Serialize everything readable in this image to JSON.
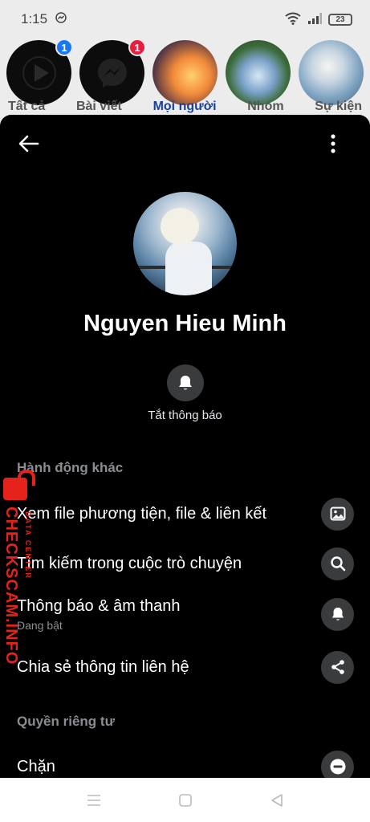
{
  "status_bar": {
    "time": "1:15",
    "battery": "23"
  },
  "background": {
    "badges": [
      "1",
      "1"
    ],
    "tabs": [
      "Tất cả",
      "Bài viết",
      "Mọi người",
      "Nhóm",
      "Sự kiện"
    ],
    "active_tab": "Mọi người"
  },
  "profile": {
    "name": "Nguyen Hieu Minh"
  },
  "mute": {
    "label": "Tắt thông báo"
  },
  "sections": {
    "more_actions": "Hành động khác",
    "privacy": "Quyền riêng tư"
  },
  "menu": {
    "media": {
      "label": "Xem file phương tiện, file & liên kết",
      "icon": "image-icon"
    },
    "search": {
      "label": "Tìm kiếm trong cuộc trò chuyện",
      "icon": "search-icon"
    },
    "notifications": {
      "label": "Thông báo & âm thanh",
      "sub": "Đang bật",
      "icon": "bell-icon"
    },
    "share": {
      "label": "Chia sẻ thông tin liên hệ",
      "icon": "share-icon"
    },
    "block": {
      "label": "Chặn",
      "icon": "minus-circle-icon"
    }
  },
  "watermark": {
    "text": "CHECKSCAM.INFO",
    "sub": "DATA CENTER"
  },
  "colors": {
    "sheet_bg": "#000000",
    "icon_bg": "#3a3b3c",
    "muted_text": "#8a8d91",
    "accent_blue": "#1877f2",
    "badge_red": "#e41e3f",
    "watermark_red": "#e5231b"
  }
}
